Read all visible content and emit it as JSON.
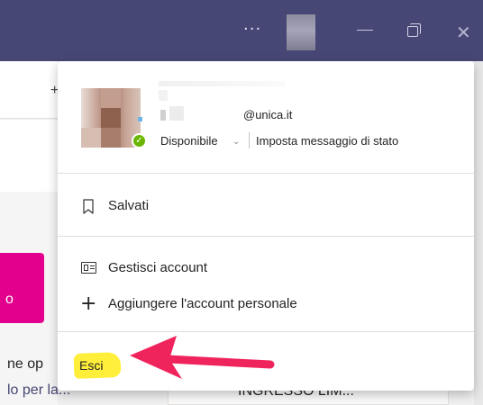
{
  "titlebar": {
    "more_icon": "more-horizontal-icon",
    "more_glyph": "···",
    "close_glyph": "✕"
  },
  "background": {
    "toolbar_plus": "+",
    "pink_tile_glyph": "o",
    "text_line1": "ne op",
    "text_line2": "lo per la...",
    "card_text": "INGRESSO LIM..."
  },
  "account_menu": {
    "email": "@unica.it",
    "status": "Disponibile",
    "status_chevron": "⌄",
    "status_badge_glyph": "✓",
    "status_color": "#6bb700",
    "set_status_message": "Imposta messaggio di stato",
    "items": [
      {
        "label": "Salvati",
        "icon": "bookmark-icon"
      },
      {
        "label": "Gestisci account",
        "icon": "id-card-icon"
      },
      {
        "label": "Aggiungere l'account personale",
        "icon": "plus-icon"
      }
    ],
    "sign_out": "Esci"
  },
  "annotations": {
    "highlight_color": "#ffef3b",
    "arrow_color": "#f0245c"
  },
  "colors": {
    "titlebar": "#464775",
    "accent_pink": "#e3008c"
  }
}
